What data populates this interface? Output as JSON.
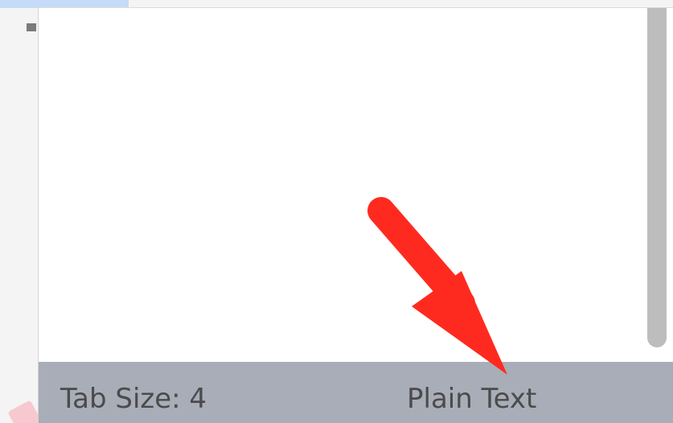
{
  "status_bar": {
    "tab_size": "Tab Size: 4",
    "language_mode": "Plain Text"
  },
  "colors": {
    "status_background": "#a8adb8",
    "status_text": "#4b4b4b",
    "annotation_arrow": "#ff2a1f",
    "scrollbar": "#bdbdbd"
  },
  "icons": {
    "annotation": "red-arrow-icon"
  }
}
